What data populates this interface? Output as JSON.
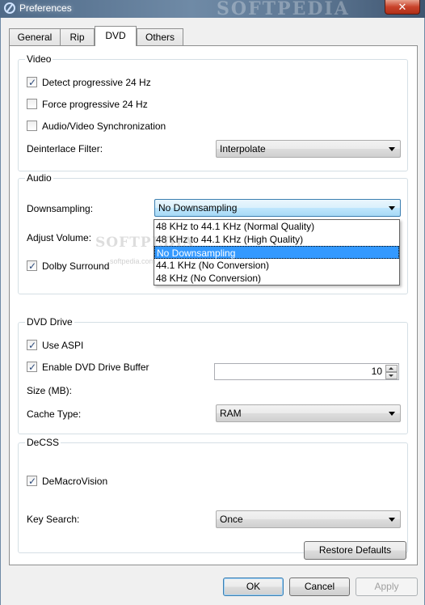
{
  "window": {
    "title": "Preferences",
    "watermark": "SOFTPEDIA"
  },
  "tabs": [
    {
      "label": "General"
    },
    {
      "label": "Rip"
    },
    {
      "label": "DVD"
    },
    {
      "label": "Others"
    }
  ],
  "video": {
    "legend": "Video",
    "detect_progressive": {
      "label": "Detect progressive 24 Hz",
      "checked": true
    },
    "force_progressive": {
      "label": "Force progressive 24 Hz",
      "checked": false
    },
    "av_sync": {
      "label": "Audio/Video Synchronization",
      "checked": false
    },
    "deinterlace_label": "Deinterlace Filter:",
    "deinterlace_value": "Interpolate"
  },
  "audio": {
    "legend": "Audio",
    "downsampling_label": "Downsampling:",
    "downsampling_value": "No Downsampling",
    "downsampling_options": [
      "48 KHz to 44.1 KHz (Normal Quality)",
      "48 KHz to 44.1 KHz (High Quality)",
      "No Downsampling",
      "44.1 KHz (No Conversion)",
      "48 KHz (No Conversion)"
    ],
    "adjust_volume_label": "Adjust Volume:",
    "dolby_surround": {
      "label": "Dolby Surround",
      "checked": true
    }
  },
  "dvd_drive": {
    "legend": "DVD Drive",
    "use_aspi": {
      "label": "Use ASPI",
      "checked": true
    },
    "enable_buffer": {
      "label": "Enable DVD Drive Buffer",
      "checked": true
    },
    "size_label": "Size (MB):",
    "size_value": "10",
    "cache_type_label": "Cache Type:",
    "cache_type_value": "RAM"
  },
  "decss": {
    "legend": "DeCSS",
    "demacrovision": {
      "label": "DeMacroVision",
      "checked": true
    },
    "key_search_label": "Key Search:",
    "key_search_value": "Once"
  },
  "buttons": {
    "restore_defaults": "Restore Defaults",
    "ok": "OK",
    "cancel": "Cancel",
    "apply": "Apply"
  },
  "watermark_small": "softpedia.com"
}
